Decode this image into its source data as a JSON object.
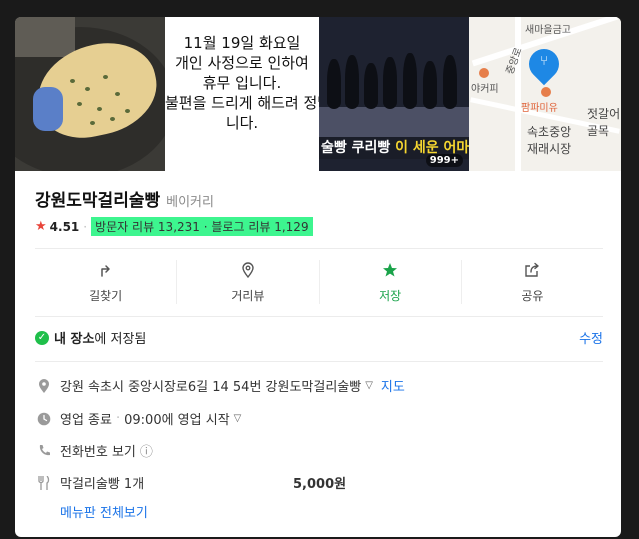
{
  "photos": {
    "notice_lines": [
      "11월 19일 화요일",
      "개인 사정으로 인하여",
      "휴무 입니다.",
      "불편을 드리게 해드려 정말 죄송",
      "니다."
    ],
    "video_caption_white": "술빵 쿠리빵 ",
    "video_caption_highlight": "이 세운 어마어마",
    "video_count": "999+",
    "map_labels": {
      "bank": "새마을금고",
      "cafe": "야커피",
      "place": "팜파미유",
      "market_line1": "속초중앙",
      "market_line2": "재래시장",
      "alley_line1": "젓갈어",
      "alley_line2": "골목",
      "road": "중앙로"
    }
  },
  "place": {
    "name": "강원도막걸리술빵",
    "category": "베이커리",
    "rating": "4.51",
    "visitor_reviews": "방문자 리뷰 13,231",
    "blog_reviews": "블로그 리뷰 1,129"
  },
  "actions": [
    {
      "label": "길찾기",
      "icon": "directions-icon"
    },
    {
      "label": "거리뷰",
      "icon": "map-pin-icon"
    },
    {
      "label": "저장",
      "icon": "star-icon"
    },
    {
      "label": "공유",
      "icon": "share-icon"
    }
  ],
  "saved": {
    "prefix": "내 장소",
    "suffix": "에 저장됨",
    "edit_label": "수정"
  },
  "info": {
    "address": "강원 속초시 중앙시장로6길 14 54번 강원도막걸리술빵",
    "map_link": "지도",
    "status": "영업 종료",
    "hours": "09:00에 영업 시작",
    "phone_link": "전화번호 보기",
    "menu_item": "막걸리술빵 1개",
    "menu_price": "5,000원",
    "menu_all_link": "메뉴판 전체보기"
  },
  "colors": {
    "accent_green": "#1aa34a",
    "review_highlight": "#3df58f",
    "link_blue": "#1a73e8",
    "star_red": "#e8443a"
  }
}
